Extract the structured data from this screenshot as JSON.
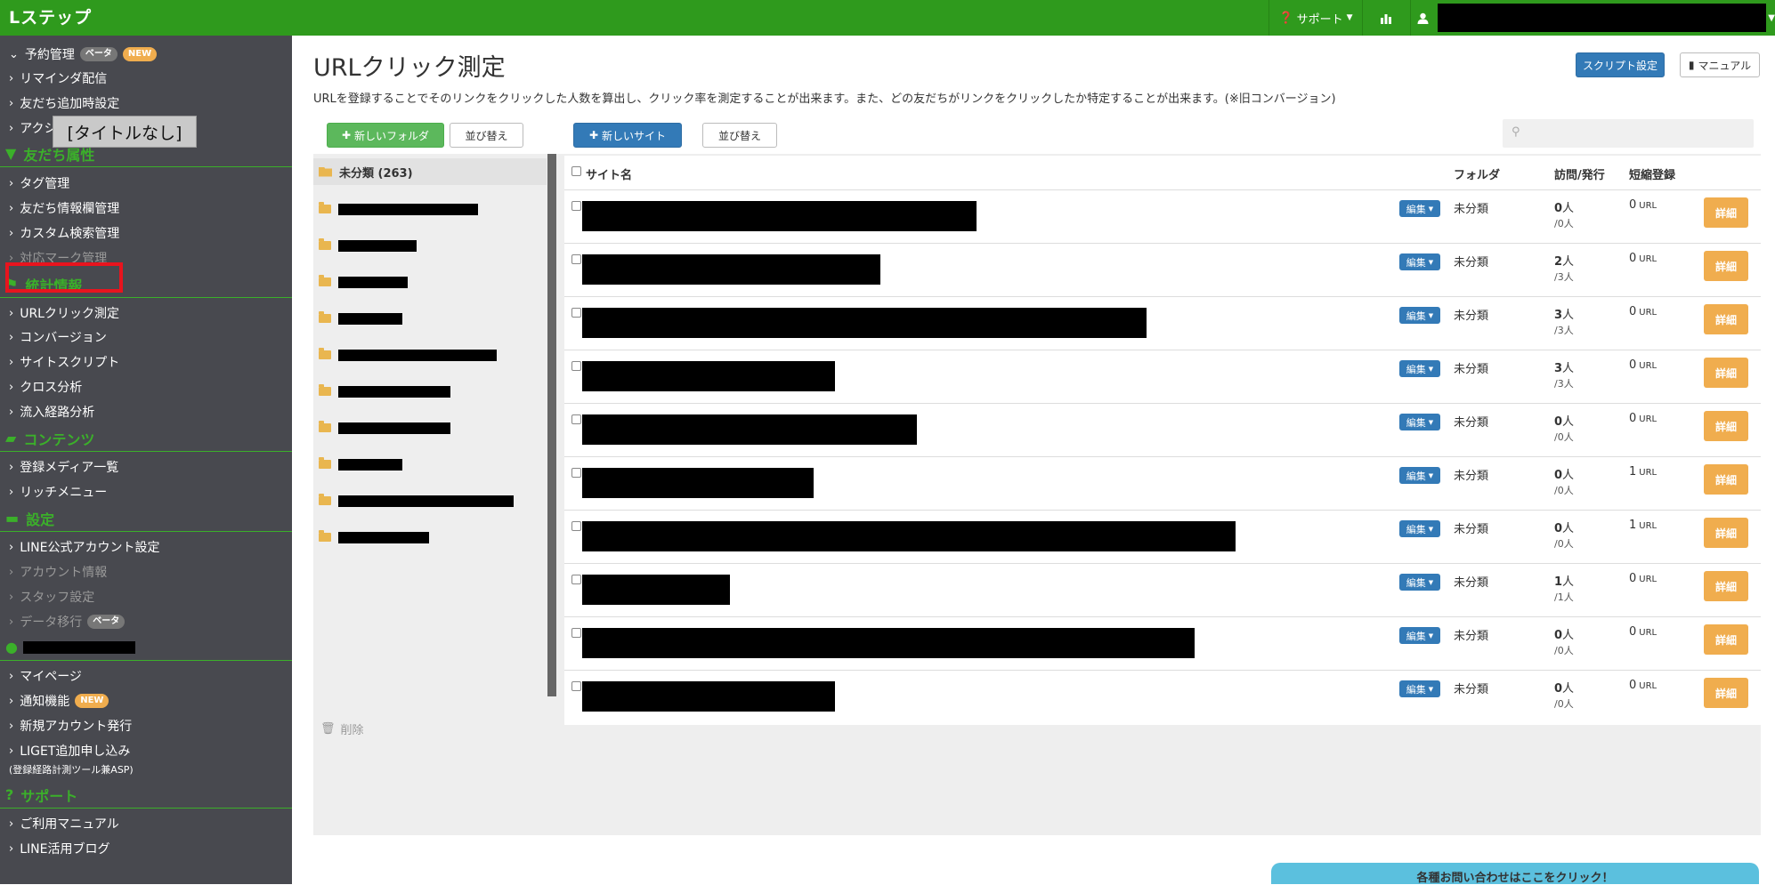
{
  "app": {
    "logo": "Lステップ"
  },
  "topbar": {
    "support_label": "サポート"
  },
  "sidebar": {
    "items": [
      {
        "label": "予約管理",
        "badges": [
          "ベータ",
          "NEW"
        ],
        "chev": "⌄"
      },
      {
        "label": "リマインダ配信"
      },
      {
        "label": "友だち追加時設定"
      },
      {
        "label": "アクシ"
      }
    ],
    "section_friends": "友だち属性",
    "friends_items": [
      "タグ管理",
      "友だち情報欄管理",
      "カスタム検索管理",
      "対応マーク管理"
    ],
    "section_stats": "統計情報",
    "stats_items": [
      "URLクリック測定",
      "コンバージョン",
      "サイトスクリプト",
      "クロス分析",
      "流入経路分析"
    ],
    "section_contents": "コンテンツ",
    "contents_items": [
      "登録メディア一覧",
      "リッチメニュー"
    ],
    "section_settings": "設定",
    "settings_items": [
      "LINE公式アカウント設定",
      "アカウント情報",
      "スタッフ設定",
      "データ移行"
    ],
    "beta_label": "ベータ",
    "account_items": [
      "マイページ",
      "通知機能",
      "新規アカウント発行",
      "LIGET追加申し込み"
    ],
    "new_label": "NEW",
    "liget_sub": "(登録経路計測ツール兼ASP)",
    "section_support": "サポート",
    "support_items": [
      "ご利用マニュアル",
      "LINE活用ブログ"
    ],
    "tooltip": "[タイトルなし]"
  },
  "main": {
    "title": "URLクリック測定",
    "description": "URLを登録することでそのリンクをクリックした人数を算出し、クリック率を測定することが出来ます。また、どの友だちがリンクをクリックしたか特定することが出来ます。(※旧コンバージョン)",
    "script_button": "スクリプト設定",
    "manual_button": "マニュアル",
    "new_folder_button": "新しいフォルダ",
    "sort_button": "並び替え",
    "new_site_button": "新しいサイト",
    "sort_button2": "並び替え",
    "active_folder": "未分類 (263)",
    "delete_label": "削除",
    "table": {
      "headers": {
        "name": "サイト名",
        "folder": "フォルダ",
        "visits": "訪問/発行",
        "short": "短縮登録"
      },
      "edit_label": "編集",
      "detail_label": "詳細",
      "url_unit": "URL",
      "rows": [
        {
          "folder": "未分類",
          "visits": "0",
          "issued": "/0人",
          "short": "0"
        },
        {
          "folder": "未分類",
          "visits": "2",
          "issued": "/3人",
          "short": "0"
        },
        {
          "folder": "未分類",
          "visits": "3",
          "issued": "/3人",
          "short": "0"
        },
        {
          "folder": "未分類",
          "visits": "3",
          "issued": "/3人",
          "short": "0"
        },
        {
          "folder": "未分類",
          "visits": "0",
          "issued": "/0人",
          "short": "0"
        },
        {
          "folder": "未分類",
          "visits": "0",
          "issued": "/0人",
          "short": "1"
        },
        {
          "folder": "未分類",
          "visits": "0",
          "issued": "/0人",
          "short": "1"
        },
        {
          "folder": "未分類",
          "visits": "1",
          "issued": "/1人",
          "short": "0"
        },
        {
          "folder": "未分類",
          "visits": "0",
          "issued": "/0人",
          "short": "0"
        },
        {
          "folder": "未分類",
          "visits": "0",
          "issued": "/0人",
          "short": "0"
        }
      ],
      "person_unit": "人"
    },
    "contact_label": "各種お問い合わせはここをクリック！"
  }
}
